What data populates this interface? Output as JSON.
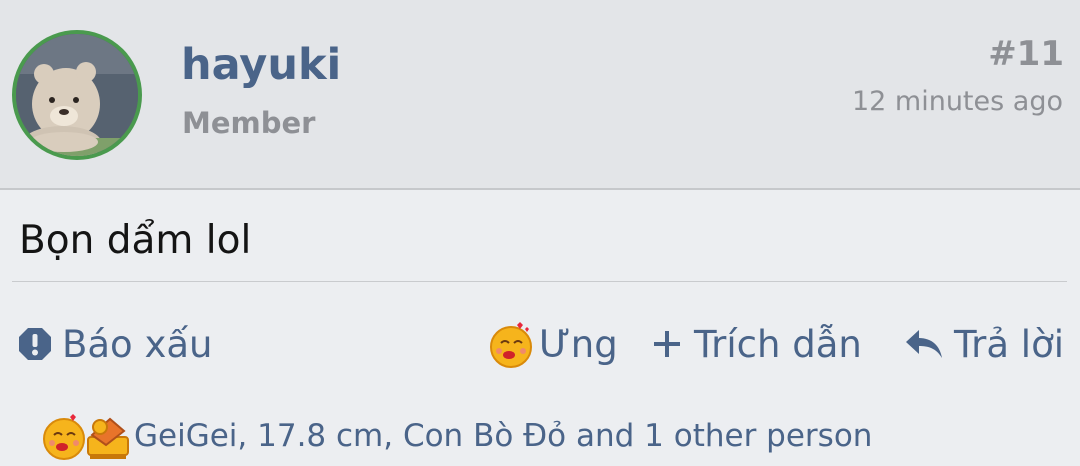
{
  "post": {
    "username": "hayuki",
    "role": "Member",
    "number": "#11",
    "time": "12 minutes ago",
    "content": "Bọn dẩm lol"
  },
  "actions": {
    "report_label": "Báo xấu",
    "like_label": "Ưng",
    "quote_label": "Trích dẫn",
    "reply_label": "Trả lời"
  },
  "reactions": {
    "summary": "GeiGei, 17.8 cm, Con Bò Đỏ and 1 other person"
  },
  "icons": {
    "report": "exclamation-icon",
    "like": "kiss-emoji-icon",
    "quote": "plus-icon",
    "reply": "reply-arrow-icon"
  },
  "colors": {
    "accent": "#4a6489",
    "muted": "#8e9095",
    "avatar_border": "#4a9a4e",
    "header_bg": "#e3e5e8",
    "body_bg": "#eceef1"
  }
}
